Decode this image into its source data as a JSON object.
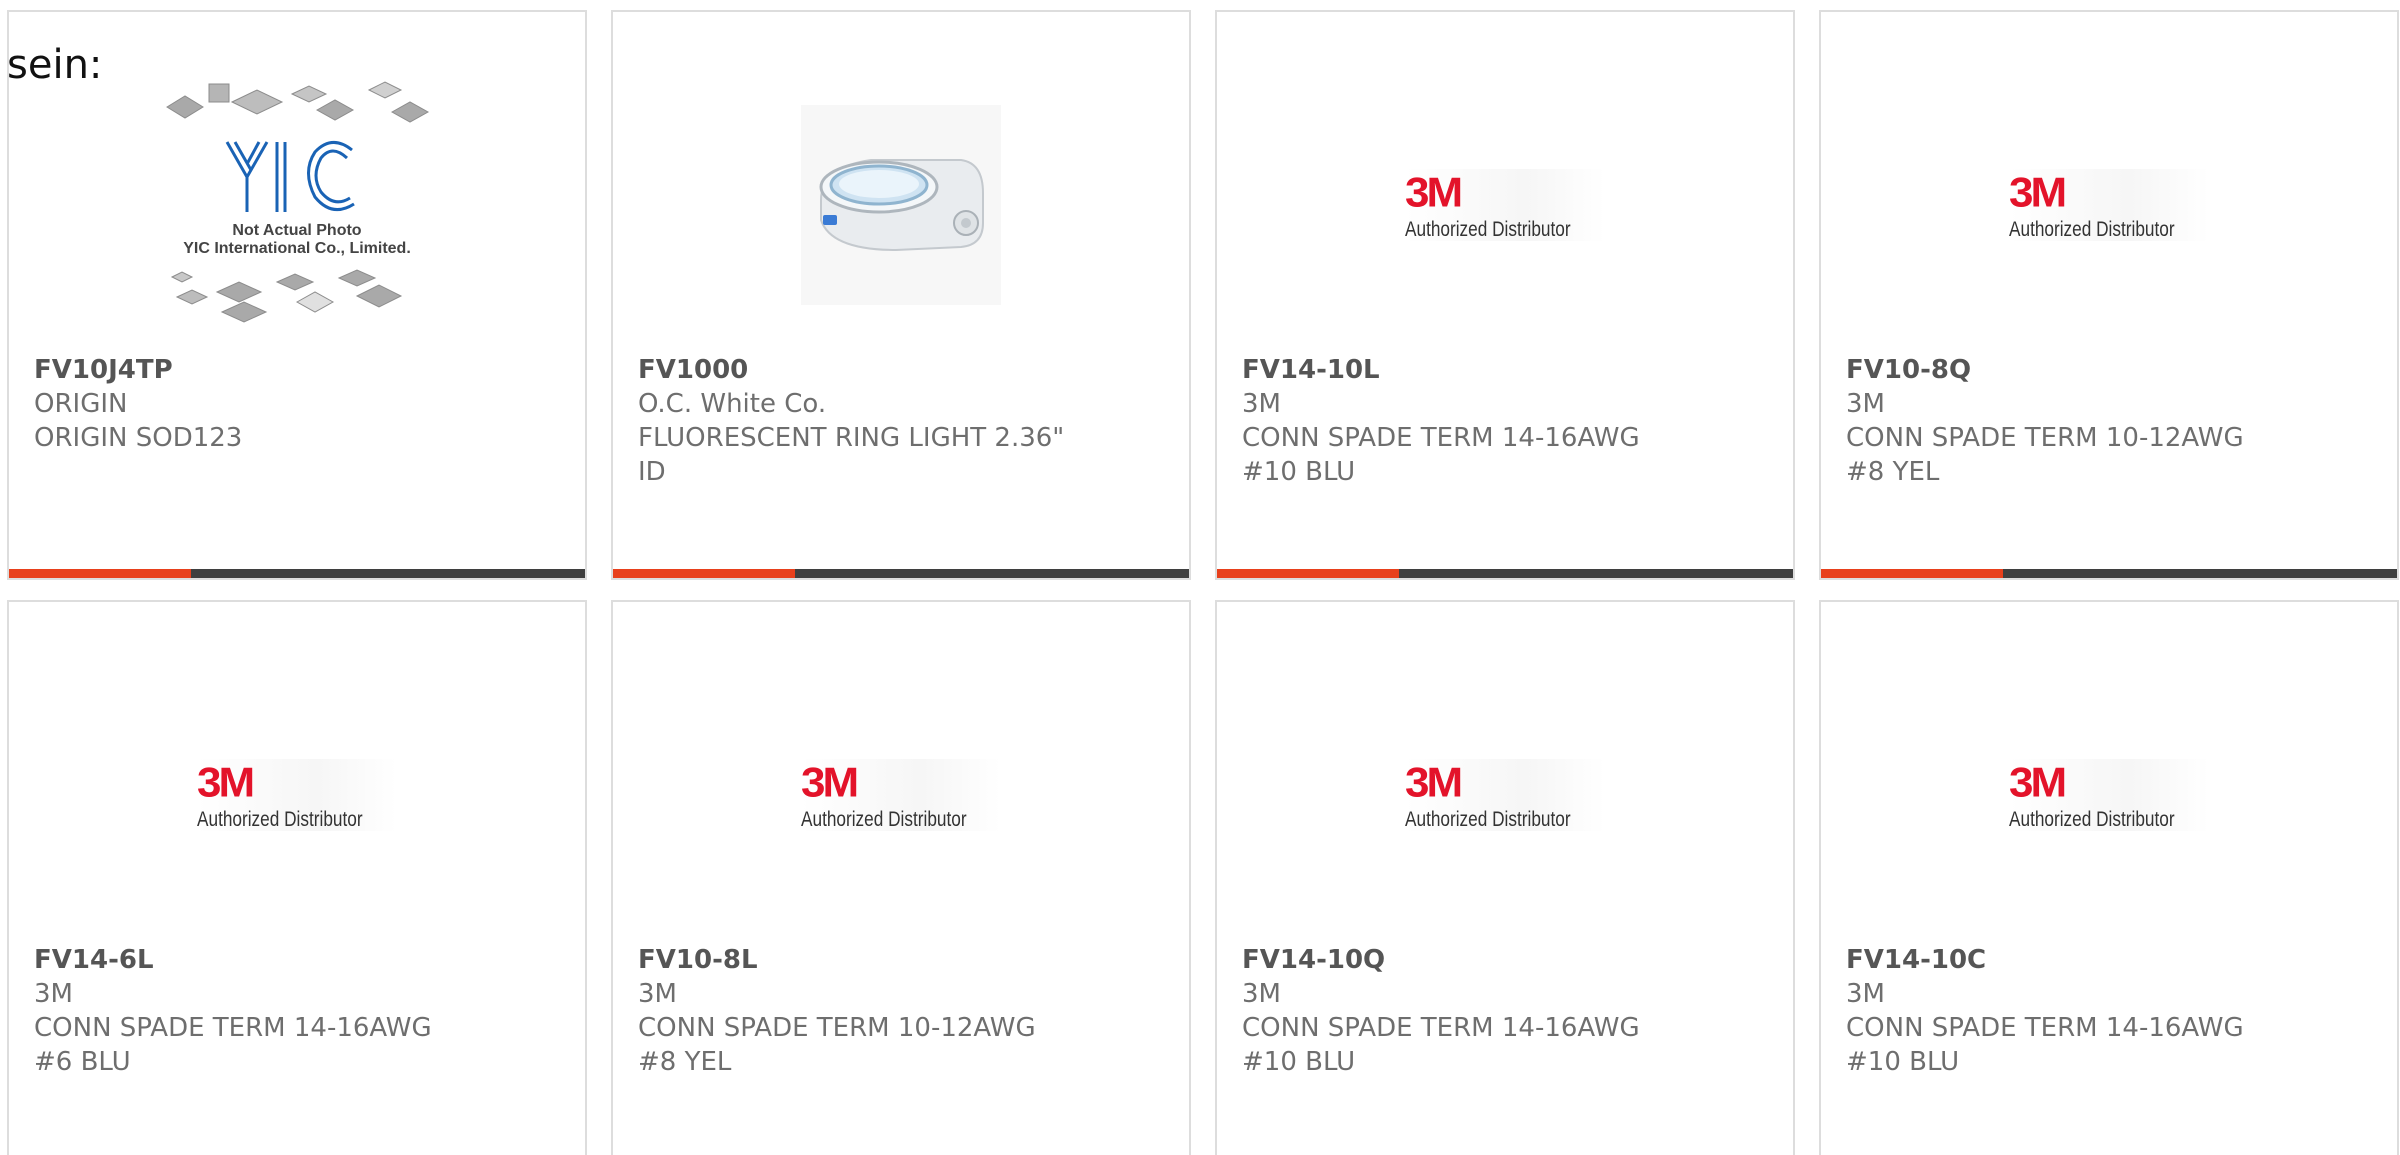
{
  "intro_text": "sein:",
  "brand_colors": {
    "accent": "#e8401c",
    "bar": "#3f3f3f",
    "logo_red": "#e3132a"
  },
  "products": [
    {
      "part": "FV10J4TP",
      "maker": "ORIGIN",
      "desc_line1": "ORIGIN SOD123",
      "desc_line2": "",
      "image": "not-actual-photo",
      "image_text_line1": "Not Actual Photo",
      "image_text_line2": "YIC International Co., Limited.",
      "image_logo_text": "YIC"
    },
    {
      "part": "FV1000",
      "maker": "O.C. White Co.",
      "desc_line1": "FLUORESCENT RING LIGHT 2.36\"",
      "desc_line2": "ID",
      "image": "ring-light-photo"
    },
    {
      "part": "FV14-10L",
      "maker": "3M",
      "desc_line1": "CONN SPADE TERM 14-16AWG",
      "desc_line2": "#10 BLU",
      "image": "3m-logo",
      "logo_mark": "3M",
      "logo_sub": "Authorized Distributor"
    },
    {
      "part": "FV10-8Q",
      "maker": "3M",
      "desc_line1": "CONN SPADE TERM 10-12AWG",
      "desc_line2": "#8 YEL",
      "image": "3m-logo",
      "logo_mark": "3M",
      "logo_sub": "Authorized Distributor"
    },
    {
      "part": "FV14-6L",
      "maker": "3M",
      "desc_line1": "CONN SPADE TERM 14-16AWG",
      "desc_line2": "#6 BLU",
      "image": "3m-logo",
      "logo_mark": "3M",
      "logo_sub": "Authorized Distributor"
    },
    {
      "part": "FV10-8L",
      "maker": "3M",
      "desc_line1": "CONN SPADE TERM 10-12AWG",
      "desc_line2": "#8 YEL",
      "image": "3m-logo",
      "logo_mark": "3M",
      "logo_sub": "Authorized Distributor"
    },
    {
      "part": "FV14-10Q",
      "maker": "3M",
      "desc_line1": "CONN SPADE TERM 14-16AWG",
      "desc_line2": "#10 BLU",
      "image": "3m-logo",
      "logo_mark": "3M",
      "logo_sub": "Authorized Distributor"
    },
    {
      "part": "FV14-10C",
      "maker": "3M",
      "desc_line1": "CONN SPADE TERM 14-16AWG",
      "desc_line2": "#10 BLU",
      "image": "3m-logo",
      "logo_mark": "3M",
      "logo_sub": "Authorized Distributor"
    }
  ]
}
